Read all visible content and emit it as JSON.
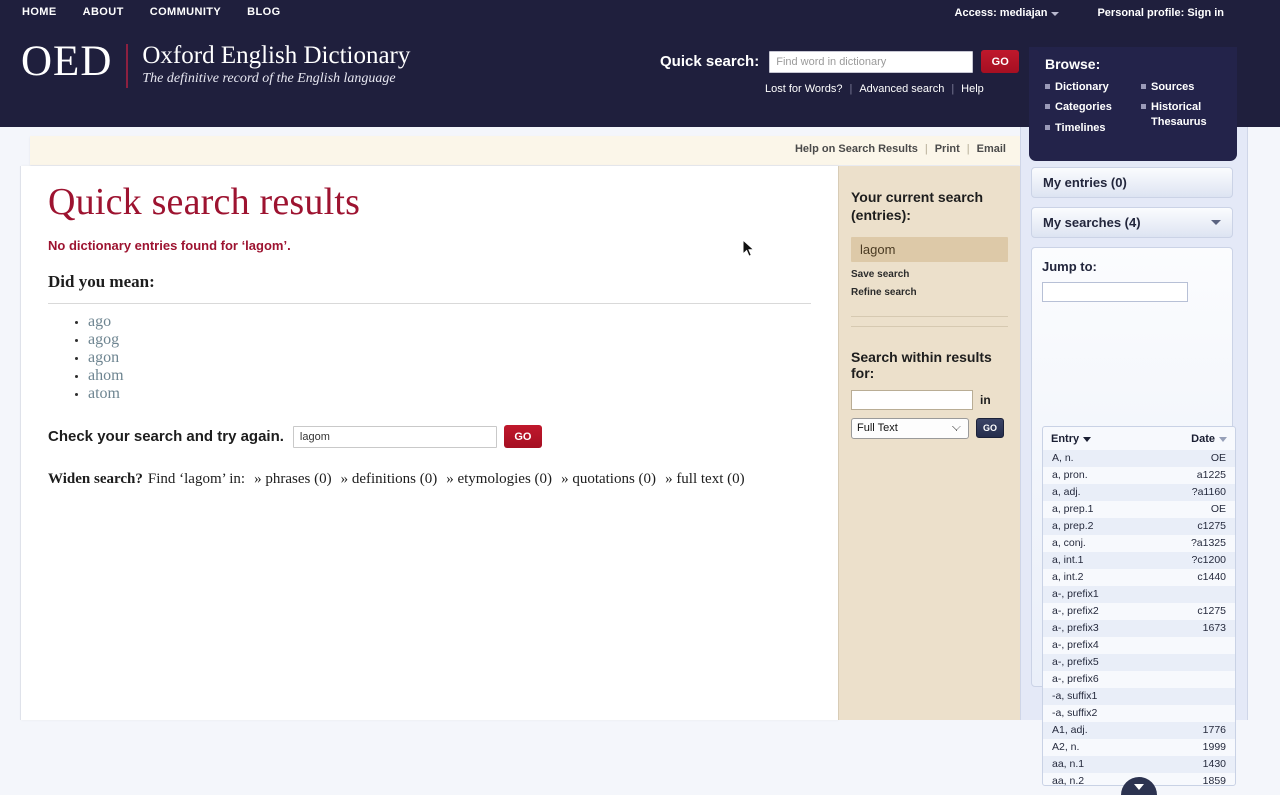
{
  "header": {
    "nav": [
      {
        "label": "HOME"
      },
      {
        "label": "ABOUT"
      },
      {
        "label": "COMMUNITY"
      },
      {
        "label": "BLOG"
      }
    ],
    "access_label": "Access: mediajan",
    "profile_label": "Personal profile:",
    "signin_label": "Sign in",
    "logo": {
      "mark": "OED",
      "title": "Oxford English Dictionary",
      "tagline": "The definitive record of the English language"
    },
    "quick_search": {
      "label": "Quick search:",
      "placeholder": "Find word in dictionary",
      "value": "",
      "go_label": "GO",
      "links": [
        {
          "label": "Lost for Words?"
        },
        {
          "label": "Advanced search"
        },
        {
          "label": "Help"
        }
      ]
    },
    "browse": {
      "title": "Browse:",
      "col1": [
        {
          "label": "Dictionary"
        },
        {
          "label": "Categories"
        },
        {
          "label": "Timelines"
        }
      ],
      "col2": [
        {
          "label": "Sources"
        },
        {
          "label": "Historical Thesaurus"
        }
      ]
    }
  },
  "toolbar": {
    "help_label": "Help on Search Results",
    "print_label": "Print",
    "email_label": "Email"
  },
  "results": {
    "title": "Quick search results",
    "no_entries": "No dictionary entries found for ‘lagom’.",
    "did_you_mean": "Did you mean:",
    "suggestions": [
      {
        "label": "ago"
      },
      {
        "label": "agog"
      },
      {
        "label": "agon"
      },
      {
        "label": "ahom"
      },
      {
        "label": "atom"
      }
    ],
    "check_label": "Check your search and try again.",
    "retry_value": "lagom",
    "retry_go_label": "GO",
    "widen": {
      "bold": "Widen search?",
      "text": "Find ‘lagom’ in:",
      "options": [
        {
          "label": "» phrases (0)"
        },
        {
          "label": "» definitions (0)"
        },
        {
          "label": "» etymologies (0)"
        },
        {
          "label": "» quotations (0)"
        },
        {
          "label": "» full text (0)"
        }
      ]
    }
  },
  "current_search": {
    "title": "Your current search (entries):",
    "term": "lagom",
    "save_label": "Save search",
    "refine_label": "Refine search",
    "within_title": "Search within results for:",
    "within_value": "",
    "in_label": "in",
    "scope_selected": "Full Text",
    "scope_options": [
      "Full Text"
    ],
    "go_label": "GO"
  },
  "rail": {
    "my_entries": "My entries (0)",
    "my_searches": "My searches (4)",
    "jump_title": "Jump to:",
    "jump_value": "",
    "entry_col": "Entry",
    "date_col": "Date",
    "entries": [
      {
        "entry": "A, n.",
        "date": "OE"
      },
      {
        "entry": "a, pron.",
        "date": "a1225"
      },
      {
        "entry": "a, adj.",
        "date": "?a1160"
      },
      {
        "entry": "a, prep.1",
        "date": "OE"
      },
      {
        "entry": "a, prep.2",
        "date": "c1275"
      },
      {
        "entry": "a, conj.",
        "date": "?a1325"
      },
      {
        "entry": "a, int.1",
        "date": "?c1200"
      },
      {
        "entry": "a, int.2",
        "date": "c1440"
      },
      {
        "entry": "a-, prefix1",
        "date": ""
      },
      {
        "entry": "a-, prefix2",
        "date": "c1275"
      },
      {
        "entry": "a-, prefix3",
        "date": "1673"
      },
      {
        "entry": "a-, prefix4",
        "date": ""
      },
      {
        "entry": "a-, prefix5",
        "date": ""
      },
      {
        "entry": "a-, prefix6",
        "date": ""
      },
      {
        "entry": "-a, suffix1",
        "date": ""
      },
      {
        "entry": "-a, suffix2",
        "date": ""
      },
      {
        "entry": "A1, adj.",
        "date": "1776"
      },
      {
        "entry": "A2, n.",
        "date": "1999"
      },
      {
        "entry": "aa, n.1",
        "date": "1430"
      },
      {
        "entry": "aa, n.2",
        "date": "1859"
      }
    ]
  },
  "colors": {
    "header_bg": "#1f1f3d",
    "accent_red": "#9d1330",
    "go_red": "#b41427",
    "cream": "#ece0cb",
    "rail_bg": "#e4e9f7"
  }
}
